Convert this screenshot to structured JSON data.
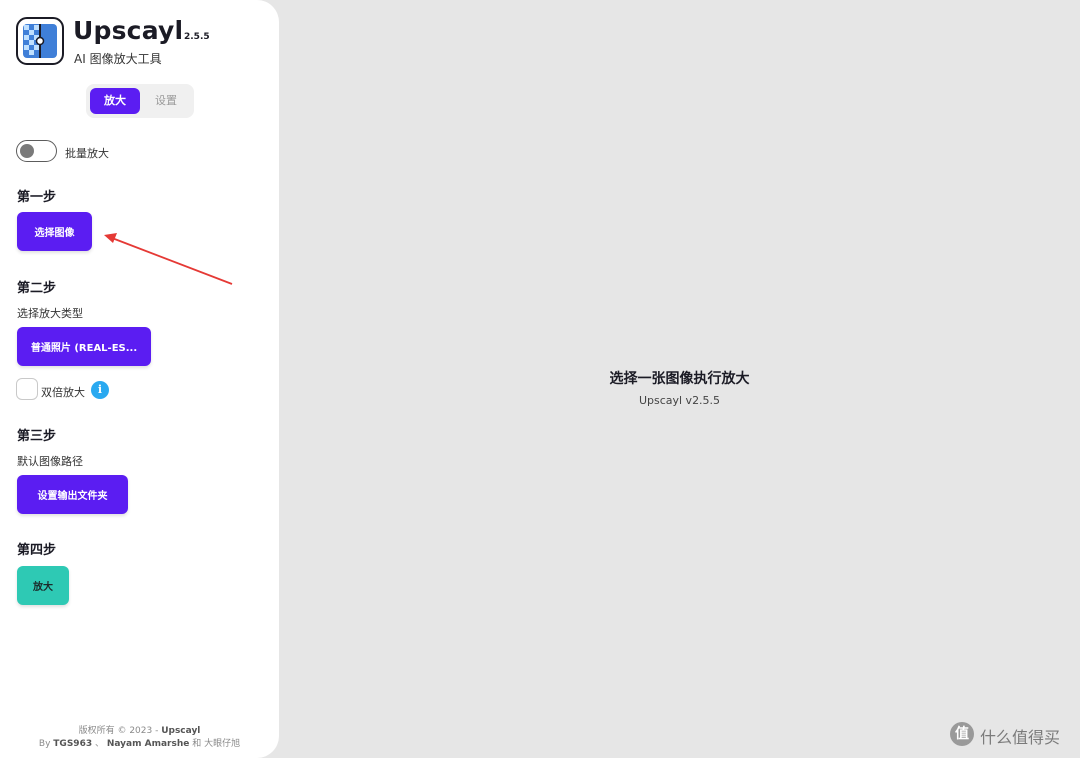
{
  "app": {
    "name": "Upscayl",
    "version": "2.5.5",
    "subtitle": "AI 图像放大工具"
  },
  "tabs": [
    {
      "label": "放大",
      "active": true
    },
    {
      "label": "设置",
      "active": false
    }
  ],
  "batch_toggle": {
    "label": "批量放大",
    "on": false
  },
  "steps": {
    "step1": {
      "title": "第一步",
      "button": "选择图像"
    },
    "step2": {
      "title": "第二步",
      "desc": "选择放大类型",
      "button": "普通照片 (REAL-ES...",
      "double_label": "双倍放大",
      "info_icon": "i"
    },
    "step3": {
      "title": "第三步",
      "desc": "默认图像路径",
      "button": "设置输出文件夹"
    },
    "step4": {
      "title": "第四步",
      "button": "放大"
    }
  },
  "footer": {
    "line1_prefix": "版权所有 © 2023 - ",
    "line1_brand": "Upscayl",
    "line2_by": "By ",
    "line2_author1": "TGS963",
    "line2_sep": " 、 ",
    "line2_author2": "Nayam Amarshe",
    "line2_suffix": " 和 大眼仔旭"
  },
  "main": {
    "title": "选择一张图像执行放大",
    "subtitle": "Upscayl v2.5.5"
  },
  "watermark": {
    "icon": "值",
    "text": "什么值得买"
  },
  "colors": {
    "primary": "#5b1df2",
    "teal": "#2ec9b4",
    "info": "#2aa9f0",
    "annotation_arrow": "#e53935",
    "main_bg": "#e6e6e6"
  }
}
